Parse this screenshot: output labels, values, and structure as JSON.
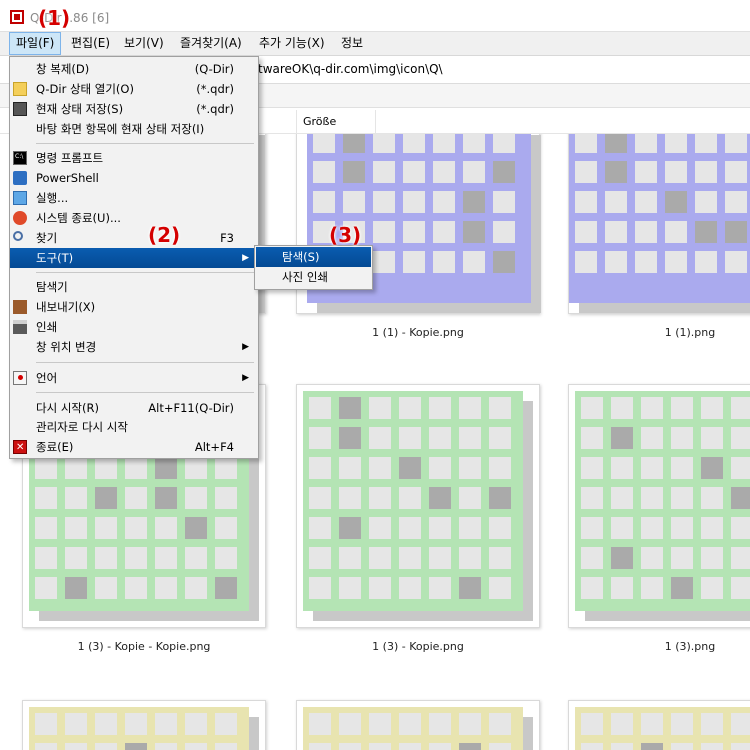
{
  "window": {
    "title": "Q-Dir ..86 [6]"
  },
  "annotations": [
    "(1)",
    "(2)",
    "(3)"
  ],
  "menubar": {
    "items": [
      "파일(F)",
      "편집(E)",
      "보기(V)",
      "즐겨찾기(A)",
      "추가 기능(X)",
      "정보"
    ]
  },
  "address": "twareOK\\q-dir.com\\img\\icon\\Q\\",
  "column_header": "Größe",
  "file_menu": {
    "items": [
      {
        "label": "창 복제(D)",
        "shortcut": "(Q-Dir)",
        "icon": "none"
      },
      {
        "label": "Q-Dir 상태 열기(O)",
        "shortcut": "(*.qdr)",
        "icon": "folder-icon"
      },
      {
        "label": "현재 상태 저장(S)",
        "shortcut": "(*.qdr)",
        "icon": "save-disk-icon"
      },
      {
        "label": "바탕 화면 항목에 현재 상태 저장(I)",
        "shortcut": "",
        "icon": "none"
      },
      {
        "label": "명령 프롬프트",
        "shortcut": "",
        "icon": "command-prompt-icon"
      },
      {
        "label": "PowerShell",
        "shortcut": "",
        "icon": "powershell-icon"
      },
      {
        "label": "실행...",
        "shortcut": "",
        "icon": "run-icon"
      },
      {
        "label": "시스템 종료(U)...",
        "shortcut": "",
        "icon": "shutdown-icon"
      },
      {
        "label": "찾기",
        "shortcut": "F3",
        "icon": "search-icon"
      },
      {
        "label": "도구(T)",
        "shortcut": "",
        "icon": "none",
        "submenu": true
      },
      {
        "label": "탐색기",
        "shortcut": "",
        "icon": "none"
      },
      {
        "label": "내보내기(X)",
        "shortcut": "",
        "icon": "export-icon"
      },
      {
        "label": "인쇄",
        "shortcut": "",
        "icon": "printer-icon"
      },
      {
        "label": "창 위치 변경",
        "shortcut": "",
        "icon": "none",
        "submenu": true
      },
      {
        "label": "언어",
        "shortcut": "",
        "icon": "language-flag-icon",
        "submenu": true
      },
      {
        "label": "다시 시작(R)",
        "shortcut": "Alt+F11(Q-Dir)",
        "icon": "none"
      },
      {
        "label": "관리자로 다시 시작",
        "shortcut": "",
        "icon": "none"
      },
      {
        "label": "종료(E)",
        "shortcut": "Alt+F4",
        "icon": "exit-icon"
      }
    ]
  },
  "tools_submenu": {
    "items": [
      "탐색(S)",
      "사진 인쇄"
    ]
  },
  "files": [
    {
      "name": "",
      "color": "#aaaaee"
    },
    {
      "name": "1 (1) - Kopie.png",
      "color": "#aaaaee"
    },
    {
      "name": "1 (1).png",
      "color": "#aaaaee"
    },
    {
      "name": "1 (3) - Kopie - Kopie.png",
      "color": "#b4e4b4"
    },
    {
      "name": "1 (3) - Kopie.png",
      "color": "#b4e4b4"
    },
    {
      "name": "1 (3).png",
      "color": "#b4e4b4"
    },
    {
      "name": "",
      "color": "#e8e4b0"
    },
    {
      "name": "",
      "color": "#e8e4b0"
    },
    {
      "name": "",
      "color": "#e8e4b0"
    }
  ]
}
